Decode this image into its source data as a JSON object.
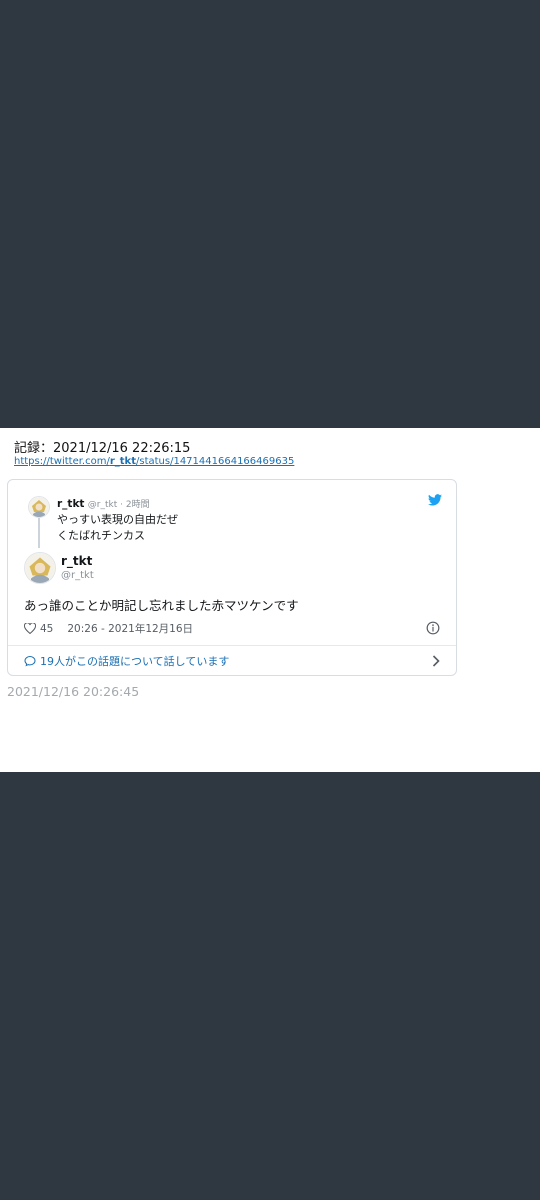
{
  "record": {
    "title": "記録：2021/12/16 22:26:15",
    "url_prefix": "https://twitter.com/",
    "url_user": "r_tkt",
    "url_suffix": "/status/1471441664166469635"
  },
  "embed": {
    "icon": "twitter-bird-icon",
    "accent_color": "#1da1f2",
    "parent_tweet": {
      "name": "r_tkt",
      "meta": "@r_tkt · 2時間",
      "lines": [
        "やっすい表現の自由だぜ",
        "くたばれチンカス"
      ]
    },
    "main_tweet": {
      "name": "r_tkt",
      "handle": "@r_tkt",
      "text": "あっ誰のことか明記し忘れました赤マツケンです",
      "likes": "45",
      "timestamp": "20:26 - 2021年12月16日"
    },
    "talking_about": "19人がこの話題について話しています"
  },
  "captured_at": "2021/12/16 20:26:45"
}
